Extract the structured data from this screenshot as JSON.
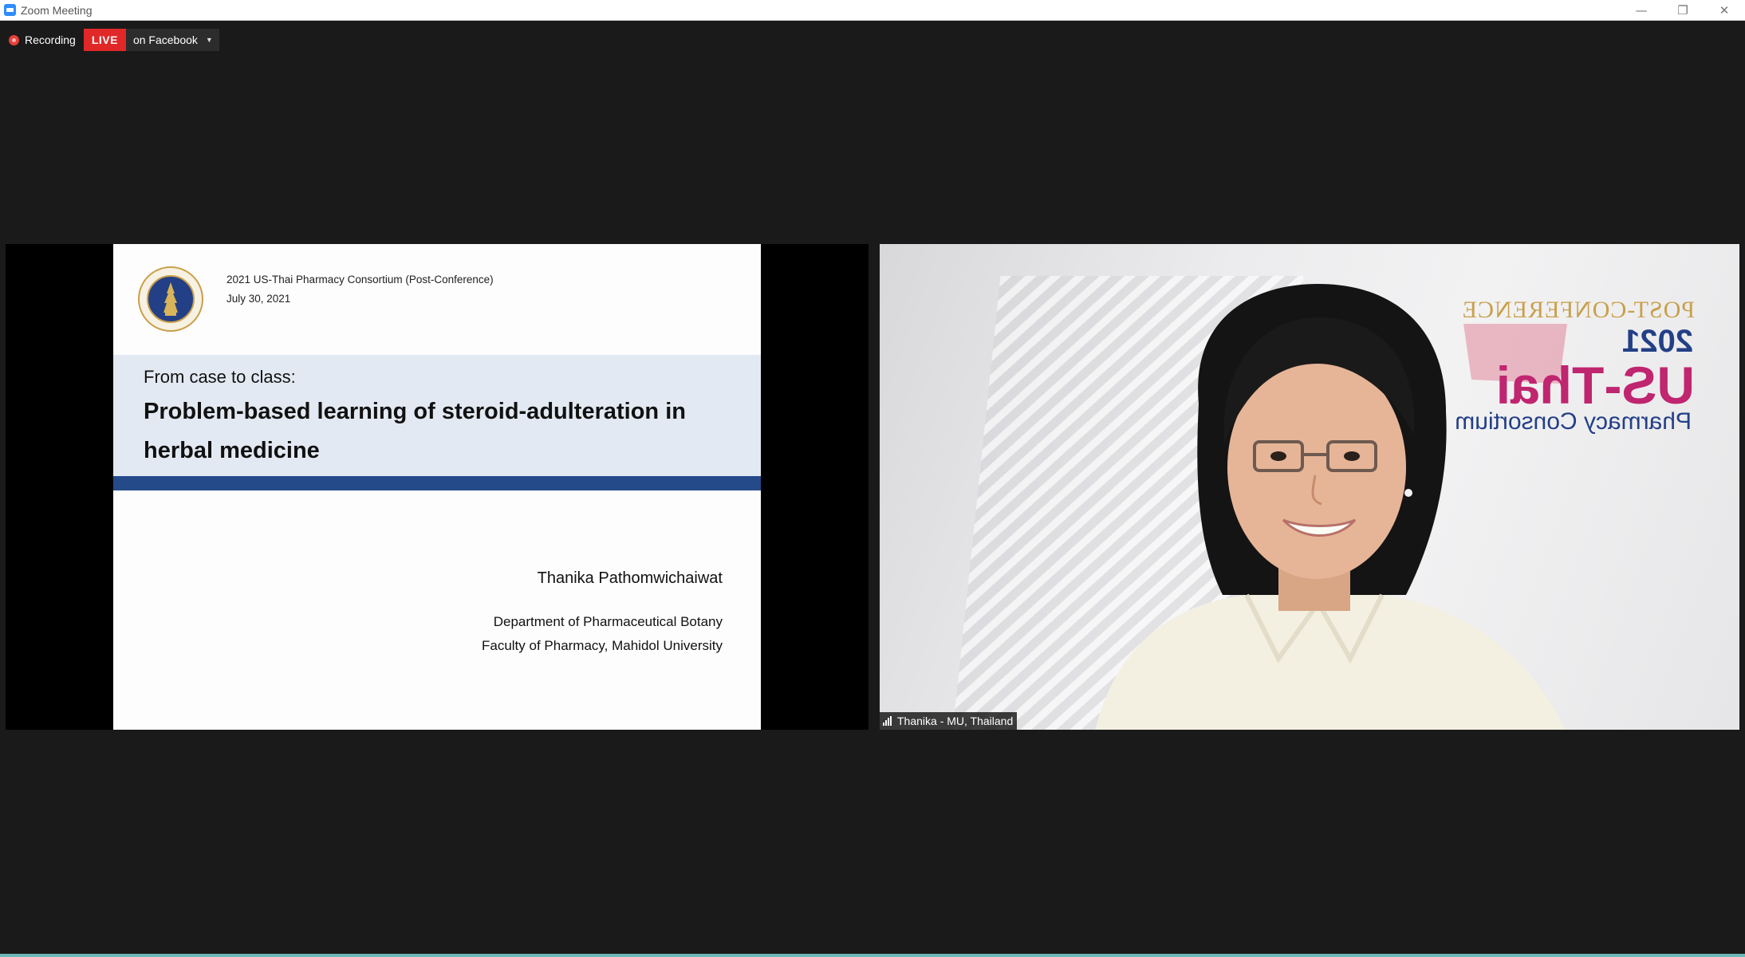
{
  "window": {
    "title": "Zoom Meeting",
    "controls": {
      "minimize": "—",
      "restore": "❐",
      "close": "✕"
    }
  },
  "status": {
    "recording_label": "Recording",
    "live_label": "LIVE",
    "live_destination": "on Facebook",
    "dropdown_glyph": "▼"
  },
  "shared_screen": {
    "conference": "2021 US-Thai Pharmacy Consortium (Post-Conference)",
    "date": "July 30, 2021",
    "kicker": "From case to class:",
    "title_line1": "Problem-based learning of steroid-adulteration in",
    "title_line2": "herbal medicine",
    "author": "Thanika Pathomwichaiwat",
    "department": "Department of Pharmaceutical Botany",
    "faculty": "Faculty of Pharmacy, Mahidol University",
    "band_color": "#e3e9f2",
    "rule_color": "#254a8a"
  },
  "video": {
    "participant_name": "Thanika - MU, Thailand",
    "background_logo": {
      "line1": "POST-CONFERENCE",
      "line2": "2021",
      "line3": "US-Thai",
      "line4": "Pharmacy Consortium"
    }
  },
  "colors": {
    "live_red": "#e02828",
    "recording_red": "#e5403a",
    "meeting_bg": "#1a1a1a"
  }
}
